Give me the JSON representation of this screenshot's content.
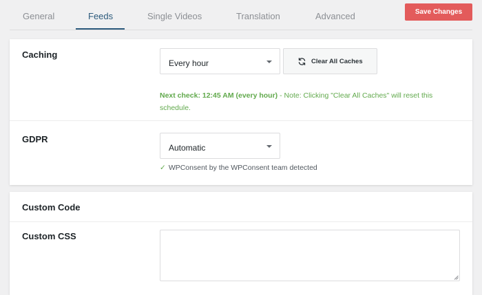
{
  "tabs": [
    {
      "label": "General"
    },
    {
      "label": "Feeds"
    },
    {
      "label": "Single Videos"
    },
    {
      "label": "Translation"
    },
    {
      "label": "Advanced"
    }
  ],
  "active_tab": "Feeds",
  "save_label": "Save Changes",
  "colors": {
    "accent": "#2c5a7c",
    "save_button": "#e35b5b",
    "success_text": "#61a94c"
  },
  "caching": {
    "label": "Caching",
    "selected": "Every hour",
    "clear_button": "Clear All Caches",
    "clear_icon": "refresh-icon",
    "next_check": "Next check: 12:45 AM (every hour)",
    "note": " - Note: Clicking \"Clear All Caches\" will reset this schedule."
  },
  "gdpr": {
    "label": "GDPR",
    "selected": "Automatic",
    "check_icon": "✓",
    "detected_text": "WPConsent by the WPConsent team detected"
  },
  "custom_code": {
    "section_title": "Custom Code",
    "css_label": "Custom CSS",
    "css_value": ""
  }
}
